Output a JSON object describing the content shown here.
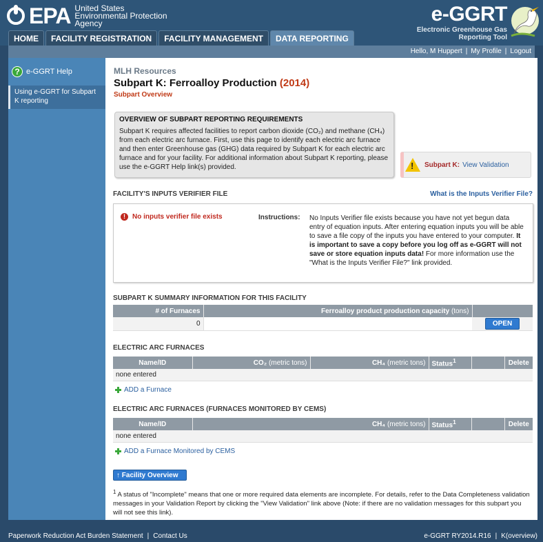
{
  "header": {
    "epa": "EPA",
    "agency": [
      "United States",
      "Environmental Protection",
      "Agency"
    ],
    "app_name": "e-GGRT",
    "app_subtitle": [
      "Electronic Greenhouse Gas",
      "Reporting Tool"
    ]
  },
  "nav": {
    "tabs": [
      "HOME",
      "FACILITY REGISTRATION",
      "FACILITY MANAGEMENT",
      "DATA REPORTING"
    ],
    "active": "DATA REPORTING"
  },
  "userbar": {
    "greeting": "Hello, M Huppert",
    "profile": "My Profile",
    "logout": "Logout"
  },
  "sidebar": {
    "help_title": "e-GGRT Help",
    "link": "Using e-GGRT for Subpart K reporting"
  },
  "page": {
    "breadcrumb": "MLH Resources",
    "title": "Subpart K: Ferroalloy Production",
    "year": "(2014)",
    "subtitle": "Subpart Overview"
  },
  "overview": {
    "heading": "OVERVIEW OF SUBPART REPORTING REQUIREMENTS",
    "text": "Subpart K requires affected facilities to report carbon dioxide (CO₂) and methane (CH₄) from each electric arc furnace. First, use this page to identify each electric arc furnace and then enter Greenhouse gas (GHG) data required by Subpart K for each electric arc furnace and for your facility. For additional information about Subpart K reporting, please use the e-GGRT Help link(s) provided."
  },
  "validation": {
    "label": "Subpart K:",
    "link": "View Validation"
  },
  "verifier": {
    "heading": "FACILITY'S INPUTS VERIFIER FILE",
    "help_link": "What is the Inputs Verifier File?",
    "status": "No inputs verifier file exists",
    "instructions_label": "Instructions:",
    "instructions_1": "No Inputs Verifier file exists because you have not yet begun data entry of equation inputs.  After entering equation inputs you will be able to save a file copy of the inputs you have entered to your computer. ",
    "instructions_bold": "It is important to save a copy before you log off as e-GGRT will not save or store equation inputs data!",
    "instructions_2": " For more information use the \"What is the Inputs Verifier File?\" link provided."
  },
  "summary": {
    "heading": "SUBPART K SUMMARY INFORMATION FOR THIS FACILITY",
    "col_furnaces": "# of Furnaces",
    "col_capacity": "Ferroalloy product production capacity",
    "col_capacity_unit": "(tons)",
    "furnaces": "0",
    "open_button": "OPEN"
  },
  "eaf": {
    "heading": "ELECTRIC ARC FURNACES",
    "columns": {
      "name": "Name/ID",
      "co2": "CO₂",
      "co2_unit": "(metric tons)",
      "ch4": "CH₄",
      "ch4_unit": "(metric tons)",
      "status": "Status",
      "status_sup": "1",
      "delete": "Delete"
    },
    "empty": "none entered",
    "add": "ADD a Furnace"
  },
  "eaf_cems": {
    "heading": "ELECTRIC ARC FURNACES (FURNACES MONITORED BY CEMS)",
    "columns": {
      "name": "Name/ID",
      "ch4": "CH₄",
      "ch4_unit": "(metric tons)",
      "status": "Status",
      "status_sup": "1",
      "delete": "Delete"
    },
    "empty": "none entered",
    "add": "ADD a Furnace Monitored by CEMS"
  },
  "facility_overview_button": "Facility Overview",
  "footnote": {
    "sup": "1",
    "text": " A status of \"Incomplete\" means that one or more required data elements are incomplete. For details, refer to the Data Completeness validation messages in your Validation Report by clicking the \"View Validation\" link above (Note: if there are no validation messages for this subpart you will not see this link)."
  },
  "footer": {
    "burden": "Paperwork Reduction Act Burden Statement",
    "contact": "Contact Us",
    "version": "e-GGRT RY2014.R16",
    "page_id": "K(overview)"
  }
}
